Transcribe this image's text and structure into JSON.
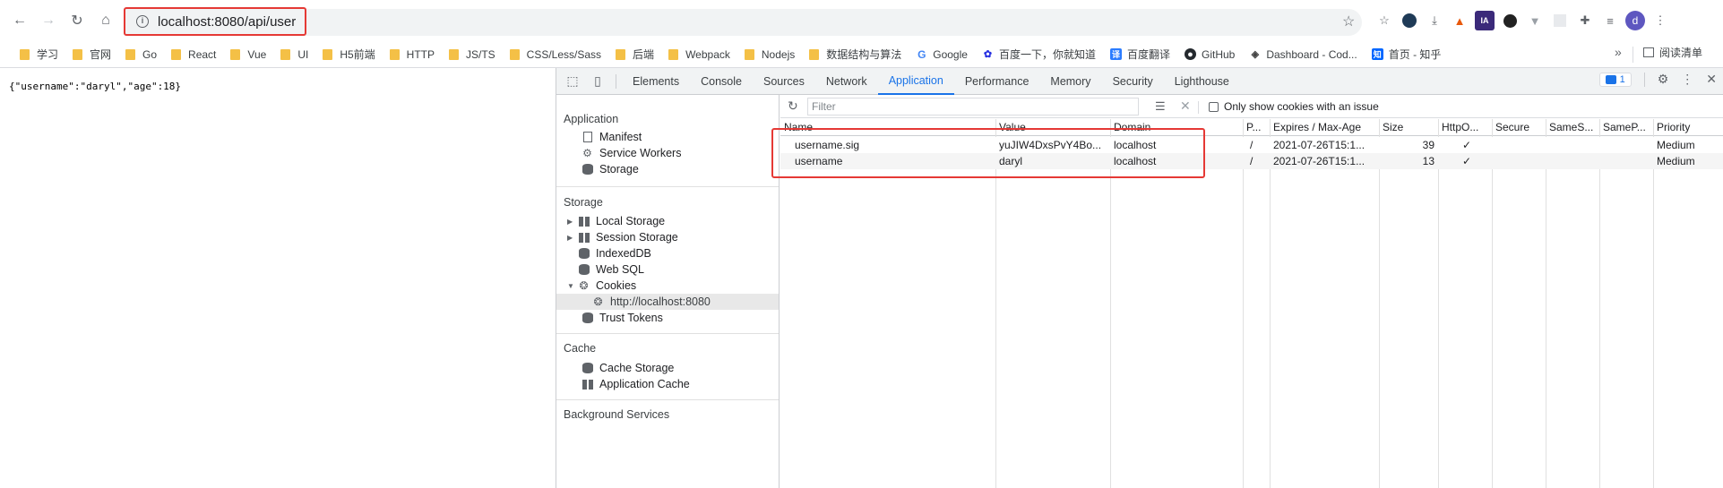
{
  "browser": {
    "url": "localhost:8080/api/user",
    "bookmarks": [
      "学习",
      "官网",
      "Go",
      "React",
      "Vue",
      "UI",
      "H5前端",
      "HTTP",
      "JS/TS",
      "CSS/Less/Sass",
      "后端",
      "Webpack",
      "Nodejs",
      "数据结构与算法"
    ],
    "bookmarks_icons": [
      {
        "label": "Google",
        "icon": "google-icon",
        "color": "#4285f4"
      },
      {
        "label": "百度一下，你就知道",
        "icon": "baidu-icon",
        "color": "#2932e1"
      },
      {
        "label": "百度翻译",
        "icon": "baidu-translate-icon",
        "color": "#2b7cff"
      },
      {
        "label": "GitHub",
        "icon": "github-icon",
        "color": "#24292e"
      },
      {
        "label": "Dashboard - Cod...",
        "icon": "codepen-icon",
        "color": "#444"
      },
      {
        "label": "首页 - 知乎",
        "icon": "zhihu-icon",
        "color": "#0066ff"
      }
    ],
    "reading_list": "阅读清单",
    "avatar": "d"
  },
  "page": {
    "json_text": "{\"username\":\"daryl\",\"age\":18}"
  },
  "devtools": {
    "tabs": [
      "Elements",
      "Console",
      "Sources",
      "Network",
      "Application",
      "Performance",
      "Memory",
      "Security",
      "Lighthouse"
    ],
    "active_tab": "Application",
    "issues_count": "1",
    "sidebar": {
      "application_header": "Application",
      "application_items": [
        "Manifest",
        "Service Workers",
        "Storage"
      ],
      "storage_header": "Storage",
      "storage_items": [
        "Local Storage",
        "Session Storage",
        "IndexedDB",
        "Web SQL",
        "Cookies"
      ],
      "cookie_origin": "http://localhost:8080",
      "trust_tokens": "Trust Tokens",
      "cache_header": "Cache",
      "cache_items": [
        "Cache Storage",
        "Application Cache"
      ],
      "background_header": "Background Services"
    },
    "cookies": {
      "filter_placeholder": "Filter",
      "only_issue_label": "Only show cookies with an issue",
      "columns": [
        "Name",
        "Value",
        "Domain",
        "P...",
        "Expires / Max-Age",
        "Size",
        "HttpO...",
        "Secure",
        "SameS...",
        "SameP...",
        "Priority"
      ],
      "rows": [
        {
          "name": "username.sig",
          "value": "yuJIW4DxsPvY4Bo...",
          "domain": "localhost",
          "path": "/",
          "expires": "2021-07-26T15:1...",
          "size": "39",
          "httponly": "✓",
          "secure": "",
          "samesite": "",
          "sameparty": "",
          "priority": "Medium"
        },
        {
          "name": "username",
          "value": "daryl",
          "domain": "localhost",
          "path": "/",
          "expires": "2021-07-26T15:1...",
          "size": "13",
          "httponly": "✓",
          "secure": "",
          "samesite": "",
          "sameparty": "",
          "priority": "Medium"
        }
      ]
    }
  }
}
